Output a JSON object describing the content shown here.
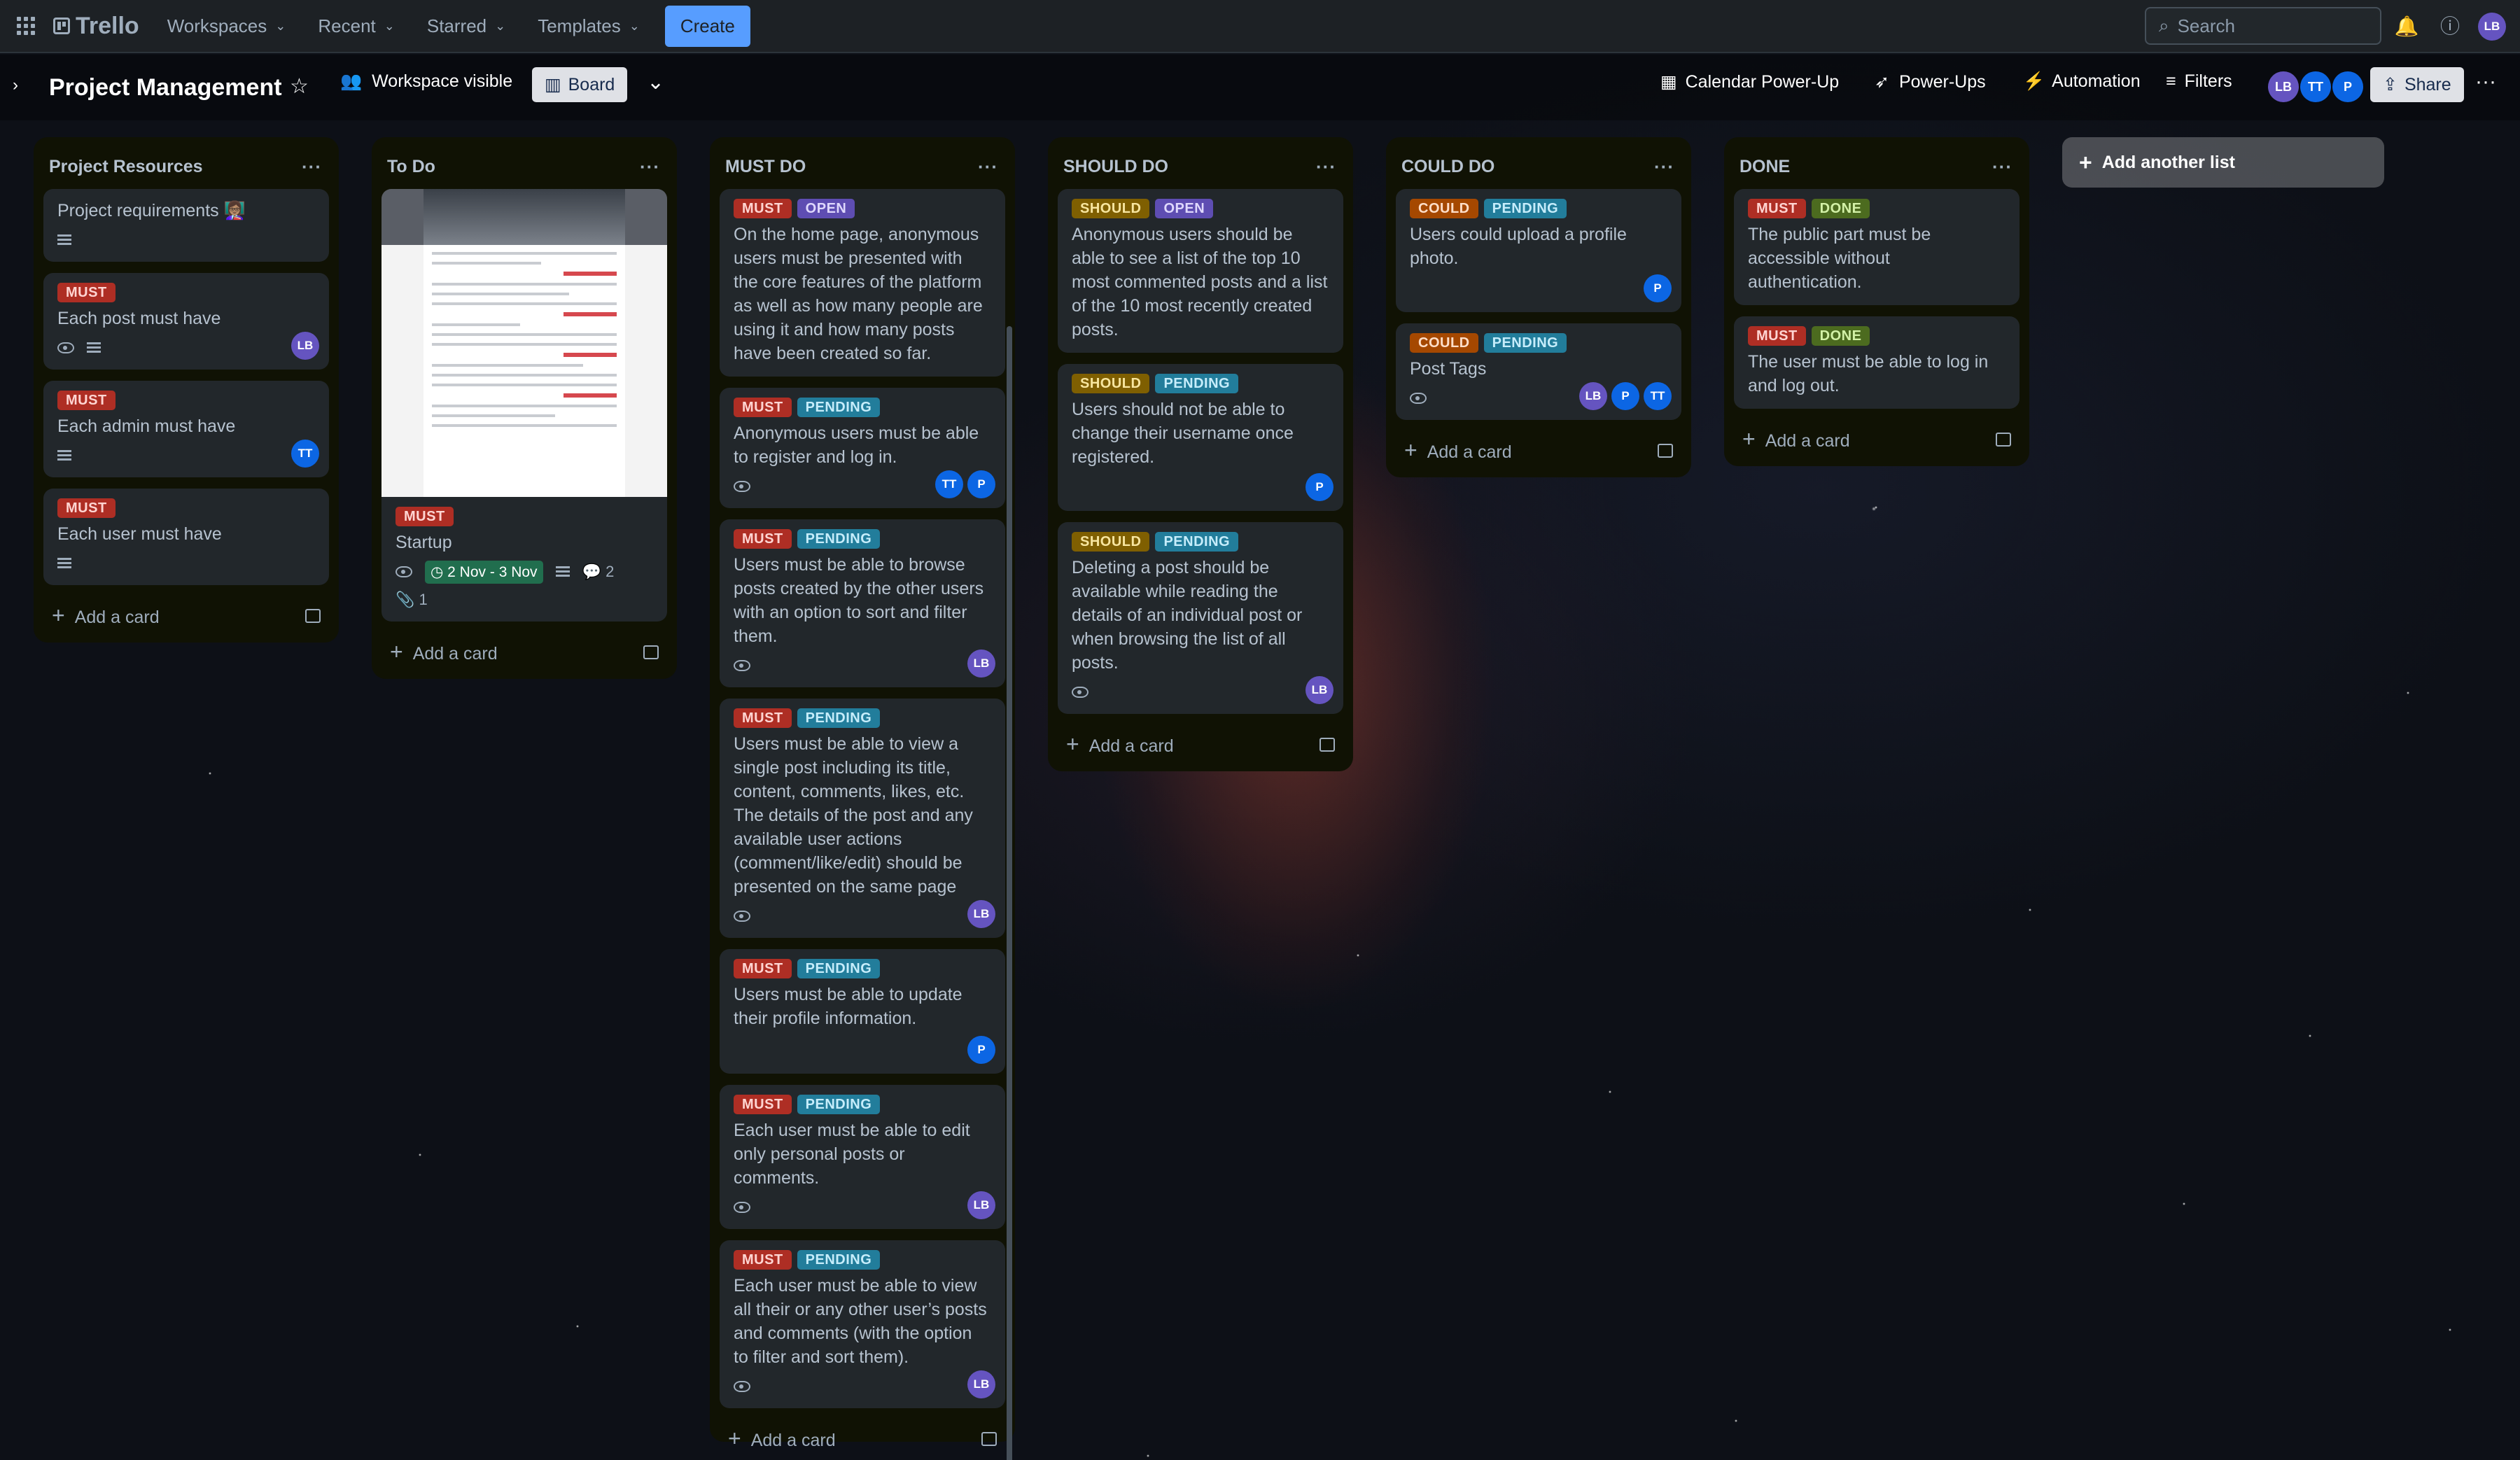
{
  "topbar": {
    "app": "Trello",
    "menus": [
      "Workspaces",
      "Recent",
      "Starred",
      "Templates"
    ],
    "create": "Create",
    "search_placeholder": "Search",
    "user": "LB"
  },
  "board": {
    "title": "Project Management",
    "visibility": "Workspace visible",
    "view": "Board",
    "calendar": "Calendar Power-Up",
    "powerups": "Power-Ups",
    "automation": "Automation",
    "filters": "Filters",
    "share": "Share",
    "members": [
      "LB",
      "TT",
      "P"
    ]
  },
  "add_card": "Add a card",
  "add_list": "Add another list",
  "lists": [
    {
      "title": "Project Resources",
      "cards": [
        {
          "text": "Project requirements 👩🏽‍🏫",
          "labels": []
        },
        {
          "text": "Each post must have",
          "labels": [
            "MUST"
          ],
          "members": [
            "LB"
          ]
        },
        {
          "text": "Each admin must have",
          "labels": [
            "MUST"
          ],
          "members": [
            "TT"
          ]
        },
        {
          "text": "Each user must have",
          "labels": [
            "MUST"
          ]
        }
      ]
    },
    {
      "title": "To Do",
      "cards": [
        {
          "text": "Startup",
          "labels": [
            "MUST"
          ],
          "date": "2 Nov - 3 Nov",
          "comments": "2",
          "attachments": "1"
        }
      ]
    },
    {
      "title": "MUST DO",
      "cards": [
        {
          "text": "On the home page, anonymous users must be presented with the core features of the platform as well as how many people are using it and how many posts have been created so far.",
          "labels": [
            "MUST",
            "OPEN"
          ]
        },
        {
          "text": "Anonymous users must be able to register and log in.",
          "labels": [
            "MUST",
            "PENDING"
          ],
          "members": [
            "TT",
            "P"
          ]
        },
        {
          "text": "Users must be able to browse posts created by the other users with an option to sort and filter them.",
          "labels": [
            "MUST",
            "PENDING"
          ],
          "members": [
            "LB"
          ]
        },
        {
          "text": "Users must be able to view a single post including its title, content, comments, likes, etc. The details of the post and any available user actions (comment/like/edit) should be presented on the same page",
          "labels": [
            "MUST",
            "PENDING"
          ],
          "members": [
            "LB"
          ]
        },
        {
          "text": "Users must be able to update their profile information.",
          "labels": [
            "MUST",
            "PENDING"
          ],
          "members": [
            "P"
          ]
        },
        {
          "text": "Each user must be able to edit only personal posts or comments.",
          "labels": [
            "MUST",
            "PENDING"
          ],
          "members": [
            "LB"
          ]
        },
        {
          "text": "Each user must be able to view all their or any other user’s posts and comments (with the option to filter and sort them).",
          "labels": [
            "MUST",
            "PENDING"
          ],
          "members": [
            "LB"
          ]
        }
      ]
    },
    {
      "title": "SHOULD DO",
      "cards": [
        {
          "text": "Anonymous users should be able to see a list of the top 10 most commented posts and a list of the 10 most recently created posts.",
          "labels": [
            "SHOULD",
            "OPEN"
          ]
        },
        {
          "text": "Users should not be able to change their username once registered.",
          "labels": [
            "SHOULD",
            "PENDING"
          ],
          "members": [
            "P"
          ]
        },
        {
          "text": "Deleting a post should be available while reading the details of an individual post or when browsing the list of all posts.",
          "labels": [
            "SHOULD",
            "PENDING"
          ],
          "members": [
            "LB"
          ]
        }
      ]
    },
    {
      "title": "COULD DO",
      "cards": [
        {
          "text": "Users could upload a profile photo.",
          "labels": [
            "COULD",
            "PENDING"
          ],
          "members": [
            "P"
          ]
        },
        {
          "text": "Post Tags",
          "labels": [
            "COULD",
            "PENDING"
          ],
          "members": [
            "LB",
            "P",
            "TT"
          ]
        }
      ]
    },
    {
      "title": "DONE",
      "cards": [
        {
          "text": "The public part must be accessible without authentication.",
          "labels": [
            "MUST",
            "DONE"
          ]
        },
        {
          "text": "The user must be able to log in and log out.",
          "labels": [
            "MUST",
            "DONE"
          ]
        }
      ]
    }
  ]
}
